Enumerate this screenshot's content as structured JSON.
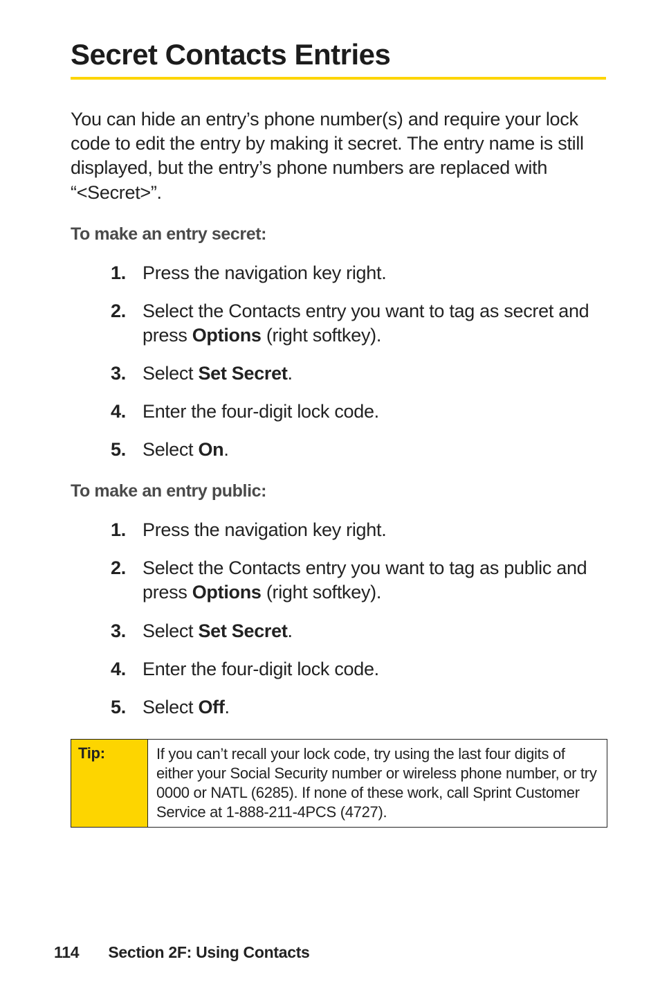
{
  "heading": "Secret Contacts Entries",
  "intro": "You can hide an entry’s phone number(s) and require your lock code to edit the entry by making it secret. The entry name is still displayed, but the entry’s phone numbers are replaced with “<Secret>”.",
  "section_secret": {
    "title": "To make an entry secret:",
    "steps": [
      {
        "text": "Press the navigation key right."
      },
      {
        "pre": "Select the Contacts entry you want to tag as secret and press ",
        "strong": "Options",
        "post": " (right softkey)."
      },
      {
        "pre": "Select ",
        "strong": "Set Secret",
        "post": "."
      },
      {
        "text": "Enter the four-digit lock code."
      },
      {
        "pre": "Select ",
        "strong": "On",
        "post": "."
      }
    ]
  },
  "section_public": {
    "title": "To make an entry public:",
    "steps": [
      {
        "text": "Press the navigation key right."
      },
      {
        "pre": "Select the Contacts entry you want to tag as public and press ",
        "strong": "Options",
        "post": " (right softkey)."
      },
      {
        "pre": "Select ",
        "strong": "Set Secret",
        "post": "."
      },
      {
        "text": "Enter the four-digit lock code."
      },
      {
        "pre": "Select ",
        "strong": "Off",
        "post": "."
      }
    ]
  },
  "tip": {
    "label": "Tip:",
    "body": "If you can’t recall your lock code, try using the last four digits of either your Social Security number or wireless phone number, or try 0000 or NATL (6285). If none of these work, call Sprint Customer Service at 1-888-211-4PCS (4727)."
  },
  "footer": {
    "page": "114",
    "section": "Section 2F: Using Contacts"
  }
}
